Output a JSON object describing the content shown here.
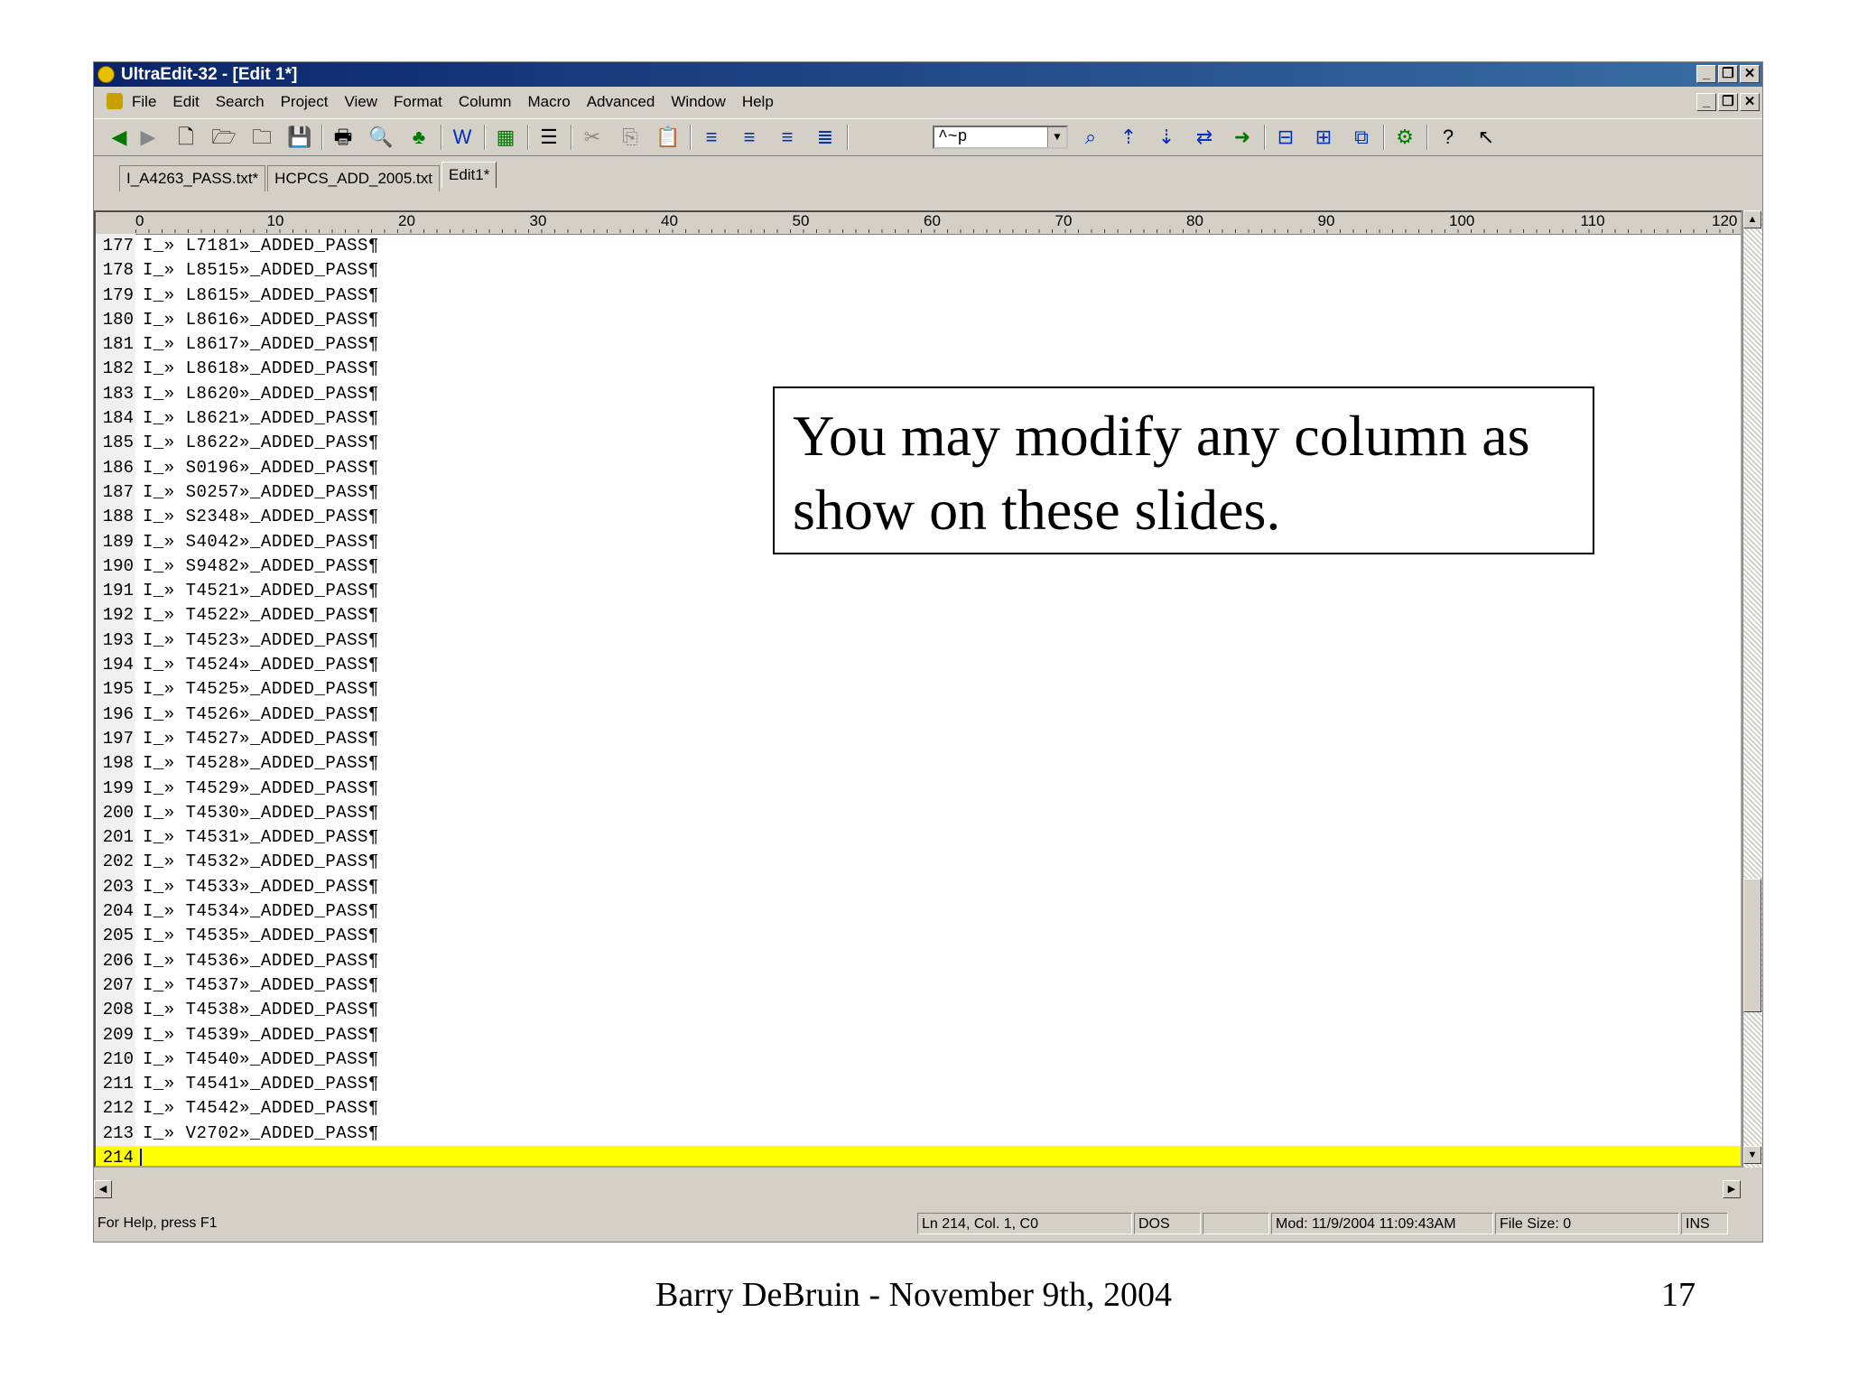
{
  "window": {
    "title": "UltraEdit-32 - [Edit 1*]"
  },
  "menu": [
    "File",
    "Edit",
    "Search",
    "Project",
    "View",
    "Format",
    "Column",
    "Macro",
    "Advanced",
    "Window",
    "Help"
  ],
  "toolbar": {
    "find_combo_value": "^~p"
  },
  "tabs": [
    {
      "label": "I_A4263_PASS.txt*",
      "active": false
    },
    {
      "label": "HCPCS_ADD_2005.txt",
      "active": false
    },
    {
      "label": "Edit1*",
      "active": true
    }
  ],
  "ruler": [
    "0",
    "10",
    "20",
    "30",
    "40",
    "50",
    "60",
    "70",
    "80",
    "90",
    "100",
    "110",
    "120"
  ],
  "editor": {
    "lines": [
      {
        "n": "177",
        "text": "I_» L7181»_ADDED_PASS¶"
      },
      {
        "n": "178",
        "text": "I_» L8515»_ADDED_PASS¶"
      },
      {
        "n": "179",
        "text": "I_» L8615»_ADDED_PASS¶"
      },
      {
        "n": "180",
        "text": "I_» L8616»_ADDED_PASS¶"
      },
      {
        "n": "181",
        "text": "I_» L8617»_ADDED_PASS¶"
      },
      {
        "n": "182",
        "text": "I_» L8618»_ADDED_PASS¶"
      },
      {
        "n": "183",
        "text": "I_» L8620»_ADDED_PASS¶"
      },
      {
        "n": "184",
        "text": "I_» L8621»_ADDED_PASS¶"
      },
      {
        "n": "185",
        "text": "I_» L8622»_ADDED_PASS¶"
      },
      {
        "n": "186",
        "text": "I_» S0196»_ADDED_PASS¶"
      },
      {
        "n": "187",
        "text": "I_» S0257»_ADDED_PASS¶"
      },
      {
        "n": "188",
        "text": "I_» S2348»_ADDED_PASS¶"
      },
      {
        "n": "189",
        "text": "I_» S4042»_ADDED_PASS¶"
      },
      {
        "n": "190",
        "text": "I_» S9482»_ADDED_PASS¶"
      },
      {
        "n": "191",
        "text": "I_» T4521»_ADDED_PASS¶"
      },
      {
        "n": "192",
        "text": "I_» T4522»_ADDED_PASS¶"
      },
      {
        "n": "193",
        "text": "I_» T4523»_ADDED_PASS¶"
      },
      {
        "n": "194",
        "text": "I_» T4524»_ADDED_PASS¶"
      },
      {
        "n": "195",
        "text": "I_» T4525»_ADDED_PASS¶"
      },
      {
        "n": "196",
        "text": "I_» T4526»_ADDED_PASS¶"
      },
      {
        "n": "197",
        "text": "I_» T4527»_ADDED_PASS¶"
      },
      {
        "n": "198",
        "text": "I_» T4528»_ADDED_PASS¶"
      },
      {
        "n": "199",
        "text": "I_» T4529»_ADDED_PASS¶"
      },
      {
        "n": "200",
        "text": "I_» T4530»_ADDED_PASS¶"
      },
      {
        "n": "201",
        "text": "I_» T4531»_ADDED_PASS¶"
      },
      {
        "n": "202",
        "text": "I_» T4532»_ADDED_PASS¶"
      },
      {
        "n": "203",
        "text": "I_» T4533»_ADDED_PASS¶"
      },
      {
        "n": "204",
        "text": "I_» T4534»_ADDED_PASS¶"
      },
      {
        "n": "205",
        "text": "I_» T4535»_ADDED_PASS¶"
      },
      {
        "n": "206",
        "text": "I_» T4536»_ADDED_PASS¶"
      },
      {
        "n": "207",
        "text": "I_» T4537»_ADDED_PASS¶"
      },
      {
        "n": "208",
        "text": "I_» T4538»_ADDED_PASS¶"
      },
      {
        "n": "209",
        "text": "I_» T4539»_ADDED_PASS¶"
      },
      {
        "n": "210",
        "text": "I_» T4540»_ADDED_PASS¶"
      },
      {
        "n": "211",
        "text": "I_» T4541»_ADDED_PASS¶"
      },
      {
        "n": "212",
        "text": "I_» T4542»_ADDED_PASS¶"
      },
      {
        "n": "213",
        "text": "I_» V2702»_ADDED_PASS¶"
      },
      {
        "n": "214",
        "text": ""
      }
    ],
    "current_line_color": "#ffff00"
  },
  "status": {
    "help": "For Help, press F1",
    "position": "Ln 214, Col. 1, C0",
    "format": "DOS",
    "modified": "Mod: 11/9/2004 11:09:43AM",
    "filesize": "File Size: 0",
    "mode": "INS"
  },
  "callout": {
    "text": "You may modify any column as show on these slides."
  },
  "footer": {
    "text": "Barry DeBruin - November 9th, 2004",
    "page": "17"
  }
}
